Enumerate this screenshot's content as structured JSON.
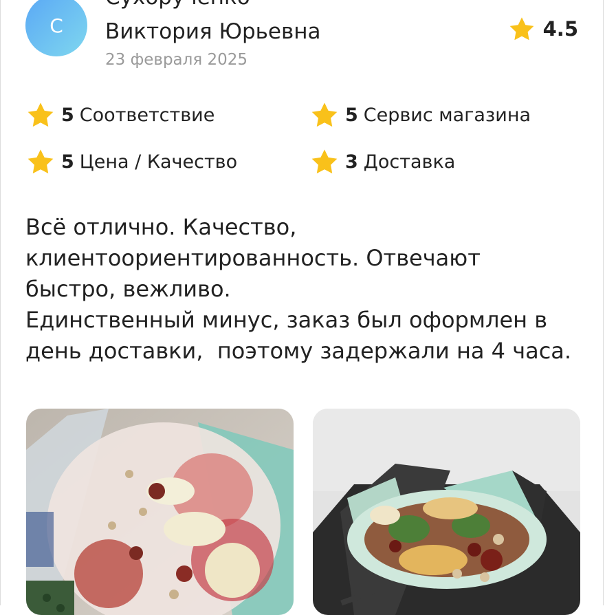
{
  "review": {
    "author_initial": "С",
    "author_surname": "Сухорученко",
    "author_name": "Виктория Юрьевна",
    "date": "23 февраля 2025",
    "overall_rating": "4.5",
    "criteria": [
      {
        "score": "5",
        "label": "Соответствие"
      },
      {
        "score": "5",
        "label": "Сервис магазина"
      },
      {
        "score": "5",
        "label": "Цена / Качество"
      },
      {
        "score": "3",
        "label": "Доставка"
      }
    ],
    "text": "Всё отлично. Качество,\nклиентоориентированность. Отвечают\nбыстро, вежливо.\nЕдинственный минус, заказ был оформлен в\nдень доставки,  поэтому задержали на 4 часа.",
    "photos": [
      {
        "icon": "bouquet-photo-1"
      },
      {
        "icon": "bouquet-photo-2"
      }
    ]
  },
  "colors": {
    "star": "#f9c11a",
    "avatar_from": "#5aa8f5",
    "avatar_to": "#7fd7ef",
    "date": "#9a9a9a"
  }
}
